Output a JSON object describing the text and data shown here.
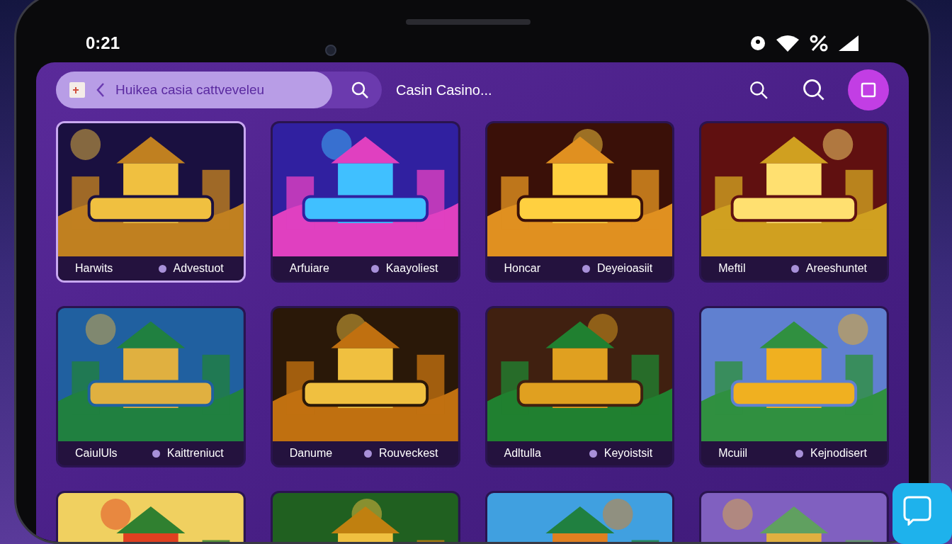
{
  "status_bar": {
    "time": "0:21"
  },
  "search": {
    "value": "Huikea casia cattveveleu"
  },
  "title": "Casin Casino...",
  "games": [
    {
      "kind": "captioned",
      "label": "Harwits",
      "tag": "Advestuot",
      "selected": true
    },
    {
      "kind": "captioned",
      "label": "Arfuiare",
      "tag": "Kaayoliest",
      "selected": false
    },
    {
      "kind": "captioned",
      "label": "Honcar",
      "tag": "Deyeioasiit",
      "selected": false
    },
    {
      "kind": "captioned",
      "label": "Meftil",
      "tag": "Areeshuntet",
      "selected": false
    },
    {
      "kind": "captioned",
      "label": "CaiulUls",
      "tag": "Kaittreniuct",
      "selected": false
    },
    {
      "kind": "captioned",
      "label": "Danume",
      "tag": "Rouveckest",
      "selected": false
    },
    {
      "kind": "captioned",
      "label": "Adltulla",
      "tag": "Keyoistsit",
      "selected": false
    },
    {
      "kind": "captioned",
      "label": "Mcuiil",
      "tag": "Kejnodisert",
      "selected": false
    },
    {
      "kind": "picture",
      "selected": false
    },
    {
      "kind": "picture",
      "selected": false
    },
    {
      "kind": "picture",
      "selected": false
    },
    {
      "kind": "picture",
      "selected": false
    }
  ]
}
